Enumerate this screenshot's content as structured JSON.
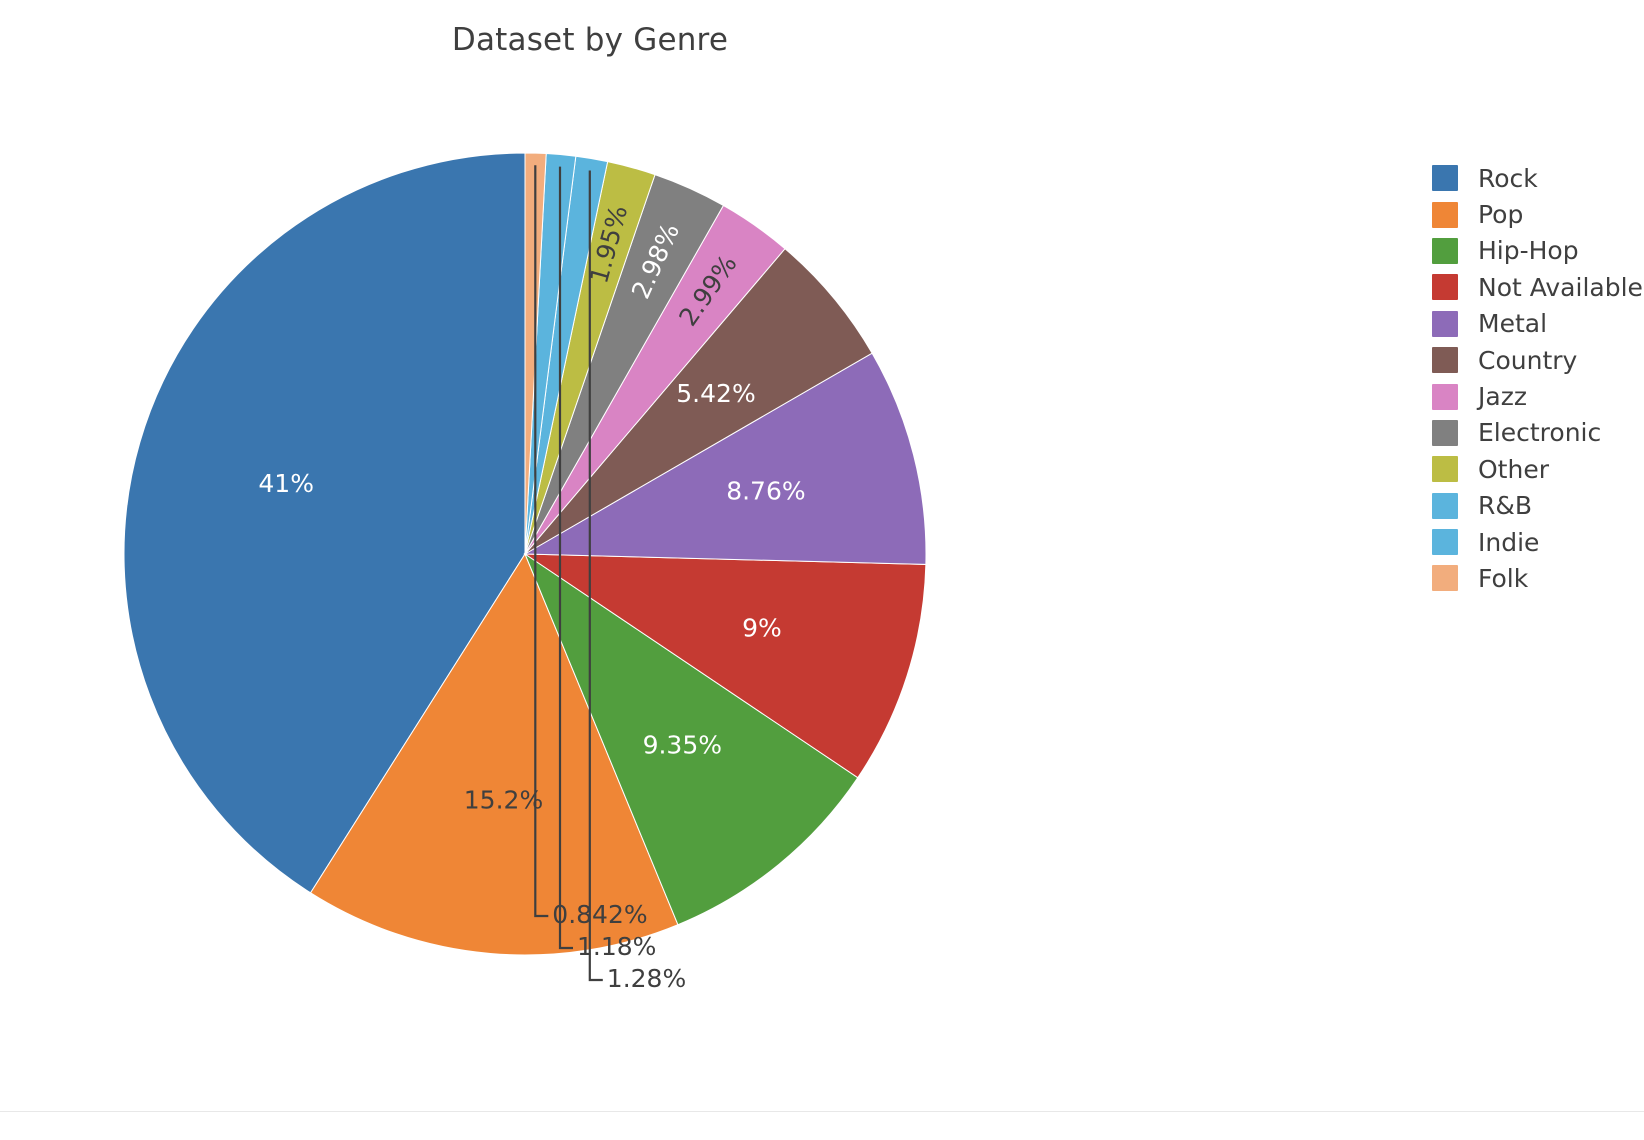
{
  "figure": {
    "title": "Dataset by Genre",
    "background_color": "#ffffff",
    "title_color": "#3f3f3f"
  },
  "legend": {
    "position": "right",
    "items": [
      {
        "label": "Rock",
        "color": "#3a76af"
      },
      {
        "label": "Pop",
        "color": "#ef8636"
      },
      {
        "label": "Hip-Hop",
        "color": "#529e3e"
      },
      {
        "label": "Not Available",
        "color": "#c53a32"
      },
      {
        "label": "Metal",
        "color": "#8d6bb8"
      },
      {
        "label": "Country",
        "color": "#7f5b55"
      },
      {
        "label": "Jazz",
        "color": "#d984c4"
      },
      {
        "label": "Electronic",
        "color": "#808080"
      },
      {
        "label": "Other",
        "color": "#bcbd44"
      },
      {
        "label": "R&B",
        "color": "#5bb4dd"
      },
      {
        "label": "Indie",
        "color": "#5bb4dd"
      },
      {
        "label": "Folk",
        "color": "#f2ad7d"
      }
    ]
  },
  "chart_data": {
    "type": "pie",
    "title": "Dataset by Genre",
    "xlabel": "",
    "ylabel": "",
    "legend_position": "right",
    "grid": false,
    "start_angle_deg": 90,
    "direction": "counterclockwise",
    "labels": [
      "Rock",
      "Pop",
      "Hip-Hop",
      "Not Available",
      "Metal",
      "Country",
      "Jazz",
      "Electronic",
      "Other",
      "R&B",
      "Indie",
      "Folk"
    ],
    "values": [
      41.0,
      15.2,
      9.35,
      9.0,
      8.76,
      5.42,
      2.99,
      2.98,
      1.95,
      1.28,
      1.18,
      0.842
    ],
    "value_unit": "percent",
    "colors": [
      "#3a76af",
      "#ef8636",
      "#529e3e",
      "#c53a32",
      "#8d6bb8",
      "#7f5b55",
      "#d984c4",
      "#808080",
      "#bcbd44",
      "#5bb4dd",
      "#5bb4dd",
      "#f2ad7d"
    ],
    "slices": [
      {
        "label": "Rock",
        "percent_text": "41%",
        "value": 41.0,
        "color": "#3a76af",
        "text_color": "#ffffff",
        "placement": "inside",
        "rotated": false
      },
      {
        "label": "Pop",
        "percent_text": "15.2%",
        "value": 15.2,
        "color": "#ef8636",
        "text_color": "#3f3f3f",
        "placement": "inside",
        "rotated": false
      },
      {
        "label": "Hip-Hop",
        "percent_text": "9.35%",
        "value": 9.35,
        "color": "#529e3e",
        "text_color": "#ffffff",
        "placement": "inside",
        "rotated": false
      },
      {
        "label": "Not Available",
        "percent_text": "9%",
        "value": 9.0,
        "color": "#c53a32",
        "text_color": "#ffffff",
        "placement": "inside",
        "rotated": false
      },
      {
        "label": "Metal",
        "percent_text": "8.76%",
        "value": 8.76,
        "color": "#8d6bb8",
        "text_color": "#ffffff",
        "placement": "inside",
        "rotated": false
      },
      {
        "label": "Country",
        "percent_text": "5.42%",
        "value": 5.42,
        "color": "#7f5b55",
        "text_color": "#ffffff",
        "placement": "inside",
        "rotated": false
      },
      {
        "label": "Jazz",
        "percent_text": "2.99%",
        "value": 2.99,
        "color": "#d984c4",
        "text_color": "#3f3f3f",
        "placement": "inside",
        "rotated": true
      },
      {
        "label": "Electronic",
        "percent_text": "2.98%",
        "value": 2.98,
        "color": "#808080",
        "text_color": "#ffffff",
        "placement": "inside",
        "rotated": true
      },
      {
        "label": "Other",
        "percent_text": "1.95%",
        "value": 1.95,
        "color": "#bcbd44",
        "text_color": "#3f3f3f",
        "placement": "inside",
        "rotated": true
      },
      {
        "label": "R&B",
        "percent_text": "1.28%",
        "value": 1.28,
        "color": "#5bb4dd",
        "text_color": "#3f3f3f",
        "placement": "outside",
        "rotated": false
      },
      {
        "label": "Indie",
        "percent_text": "1.18%",
        "value": 1.18,
        "color": "#5bb4dd",
        "text_color": "#3f3f3f",
        "placement": "outside",
        "rotated": false
      },
      {
        "label": "Folk",
        "percent_text": "0.842%",
        "value": 0.842,
        "color": "#f2ad7d",
        "text_color": "#3f3f3f",
        "placement": "outside",
        "rotated": false
      }
    ]
  }
}
